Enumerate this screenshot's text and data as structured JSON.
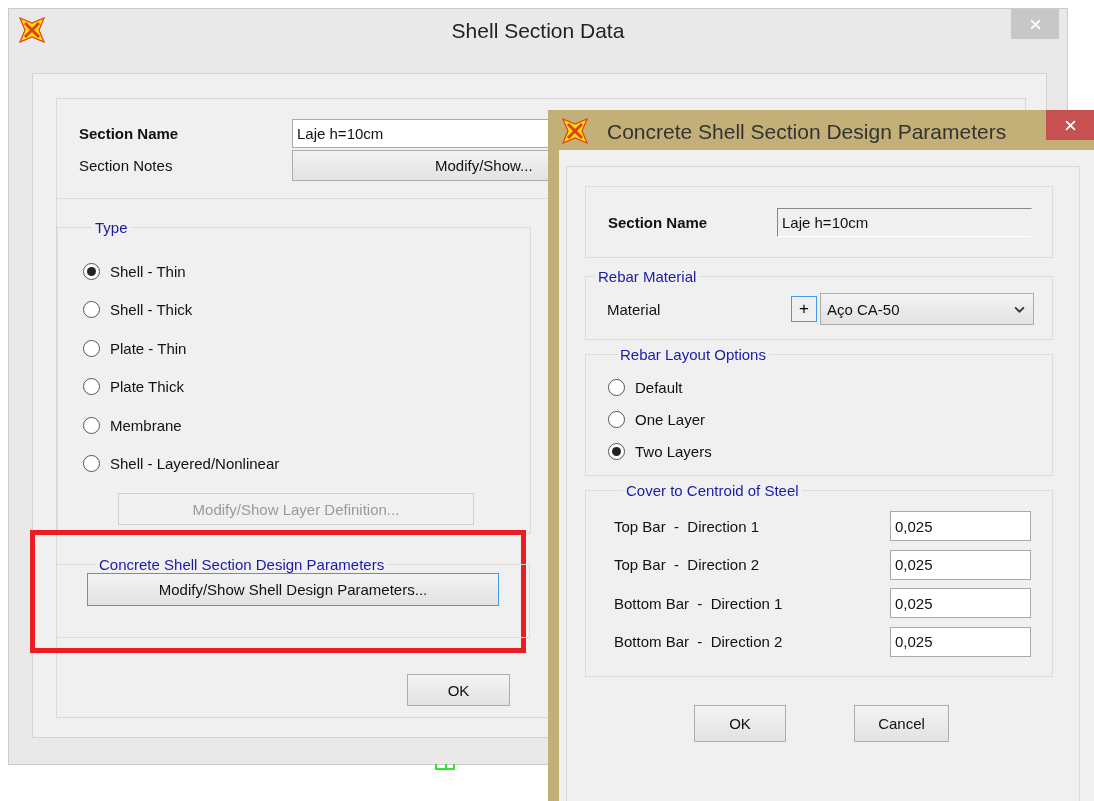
{
  "main_window": {
    "title": "Shell Section Data",
    "section_name_label": "Section Name",
    "section_name_value": "Laje h=10cm",
    "section_notes_label": "Section Notes",
    "section_notes_button": "Modify/Show...",
    "type_group": {
      "title": "Type",
      "options": [
        {
          "label": "Shell - Thin",
          "selected": true
        },
        {
          "label": "Shell - Thick",
          "selected": false
        },
        {
          "label": "Plate - Thin",
          "selected": false
        },
        {
          "label": "Plate Thick",
          "selected": false
        },
        {
          "label": "Membrane",
          "selected": false
        },
        {
          "label": "Shell - Layered/Nonlinear",
          "selected": false
        }
      ],
      "layer_button": {
        "label": "Modify/Show Layer Definition...",
        "disabled": true
      }
    },
    "design_group": {
      "title": "Concrete Shell Section Design Parameters",
      "button": "Modify/Show Shell Design Parameters...",
      "highlighted": true
    },
    "ok_button": "OK"
  },
  "dialog": {
    "title": "Concrete Shell Section Design Parameters",
    "section_name_label": "Section Name",
    "section_name_value": "Laje h=10cm",
    "rebar_material": {
      "title": "Rebar Material",
      "label": "Material",
      "add_button": "+",
      "value": "Aço CA-50"
    },
    "layout_options": {
      "title": "Rebar Layout Options",
      "options": [
        {
          "label": "Default",
          "selected": false
        },
        {
          "label": "One Layer",
          "selected": false
        },
        {
          "label": "Two Layers",
          "selected": true
        }
      ]
    },
    "cover": {
      "title": "Cover to Centroid of Steel",
      "rows": [
        {
          "label": "Top Bar  -  Direction 1",
          "value": "0,025"
        },
        {
          "label": "Top Bar  -  Direction 2",
          "value": "0,025"
        },
        {
          "label": "Bottom Bar  -  Direction 1",
          "value": "0,025"
        },
        {
          "label": "Bottom Bar  -  Direction 2",
          "value": "0,025"
        }
      ]
    },
    "buttons": [
      "OK",
      "Cancel"
    ]
  }
}
